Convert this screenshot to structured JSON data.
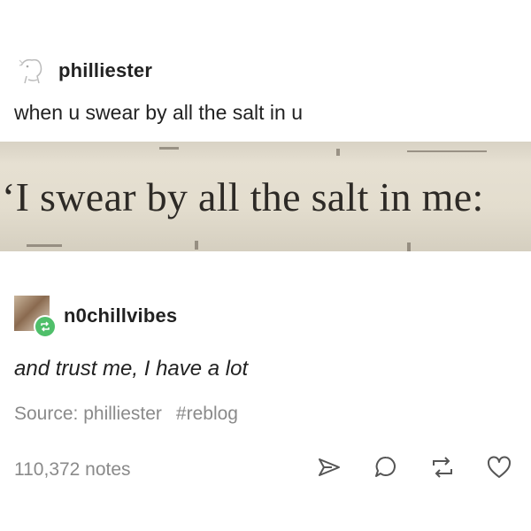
{
  "post": {
    "author": "philliester",
    "caption": "when u swear by all the salt in u",
    "image_text": "‘I swear by all the salt in me:",
    "reblogger": "n0chillvibes",
    "reply": "and trust me, I have a lot",
    "source_label": "Source: philliester",
    "tag": "#reblog",
    "notes": "110,372 notes"
  },
  "actions": [
    "share-icon",
    "reply-icon",
    "reblog-icon",
    "like-icon"
  ],
  "colors": {
    "muted": "#8a8a8a",
    "reblog_badge": "#4fbf6a",
    "text": "#222222"
  }
}
